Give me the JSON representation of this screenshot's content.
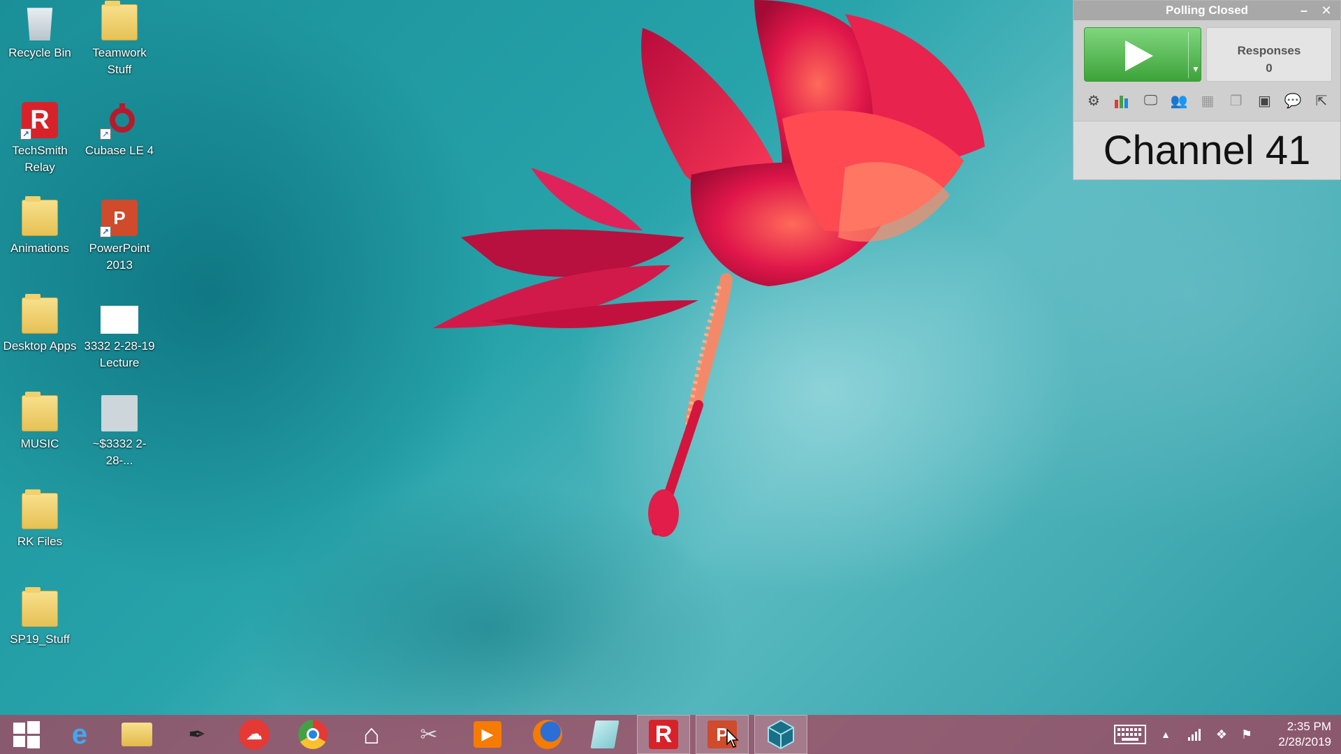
{
  "desktop": {
    "icons": [
      {
        "label": "Recycle Bin"
      },
      {
        "label": "Teamwork Stuff"
      },
      {
        "label": "TechSmith Relay"
      },
      {
        "label": "Cubase LE 4"
      },
      {
        "label": "Animations"
      },
      {
        "label": "PowerPoint 2013"
      },
      {
        "label": "Desktop Apps"
      },
      {
        "label": "3332 2-28-19 Lecture"
      },
      {
        "label": "MUSIC"
      },
      {
        "label": "~$3332 2-28-..."
      },
      {
        "label": "RK Files"
      },
      {
        "label": "SP19_Stuff"
      }
    ]
  },
  "poll_widget": {
    "title": "Polling Closed",
    "responses_label": "Responses",
    "responses_count": "0",
    "channel": "Channel 41",
    "tools": [
      "settings-icon",
      "bar-chart-icon",
      "display-icon",
      "participants-icon",
      "grid-icon",
      "stack-icon",
      "image-icon",
      "chat-icon",
      "export-icon"
    ]
  },
  "taskbar": {
    "apps": [
      "start",
      "internet-explorer",
      "file-explorer",
      "pen-tool",
      "cloud",
      "chrome",
      "home",
      "snipping-tool",
      "media-player",
      "firefox",
      "notes",
      "techsmith-relay",
      "powerpoint",
      "3d-app"
    ],
    "clock_time": "2:35 PM",
    "clock_date": "2/28/2019"
  },
  "colors": {
    "taskbar": "#a5465f",
    "play_green": "#3da33a",
    "poll_bg": "#cfcfcf"
  }
}
